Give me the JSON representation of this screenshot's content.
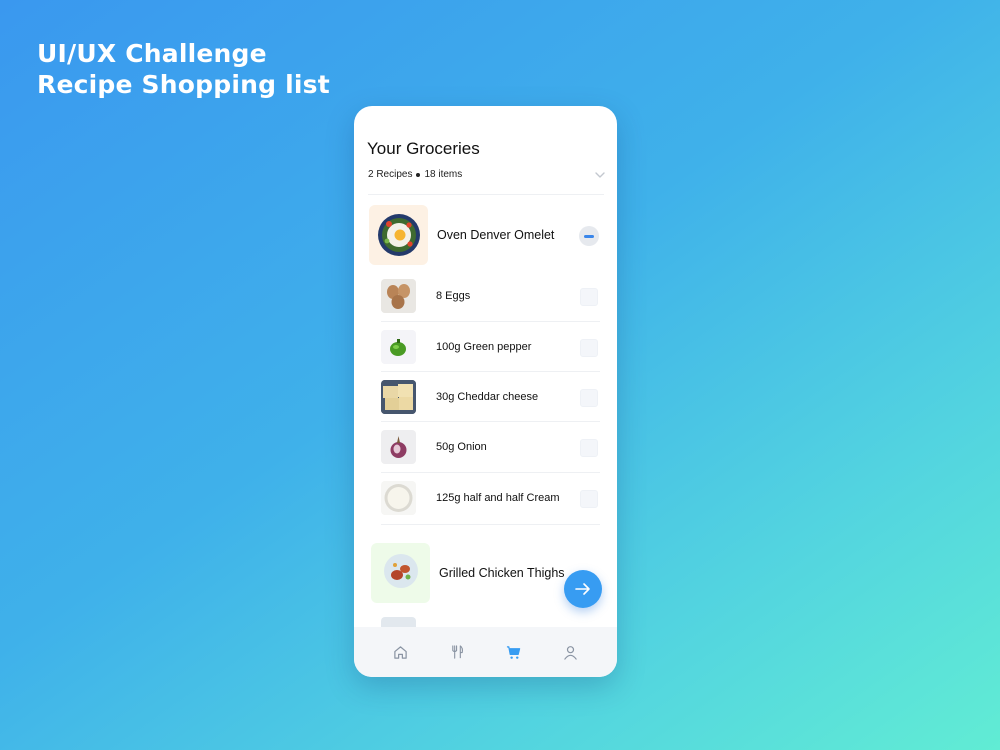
{
  "headline": {
    "line1": "UI/UX Challenge",
    "line2": "Recipe Shopping list"
  },
  "header": {
    "title": "Your Groceries",
    "recipes_count": "2 Recipes",
    "items_count": "18 items"
  },
  "recipes": [
    {
      "name": "Oven Denver Omelet",
      "thumb_bg": "#fdf1e4",
      "expanded": true,
      "ingredients": [
        {
          "label": "8 Eggs",
          "icon": "eggs-image"
        },
        {
          "label": "100g Green pepper",
          "icon": "green-pepper-image"
        },
        {
          "label": "30g Cheddar cheese",
          "icon": "cheddar-cheese-image"
        },
        {
          "label": "50g Onion",
          "icon": "onion-image"
        },
        {
          "label": "125g half and half Cream",
          "icon": "cream-image"
        }
      ]
    },
    {
      "name": "Grilled Chicken Thighs",
      "thumb_bg": "#eefbe9",
      "expanded": false
    }
  ],
  "nav": [
    {
      "icon": "home-icon",
      "active": false
    },
    {
      "icon": "fork-knife-icon",
      "active": false
    },
    {
      "icon": "cart-icon",
      "active": true
    },
    {
      "icon": "profile-icon",
      "active": false
    }
  ],
  "colors": {
    "accent": "#379cf2",
    "inactive_icon": "#8a94a3"
  }
}
